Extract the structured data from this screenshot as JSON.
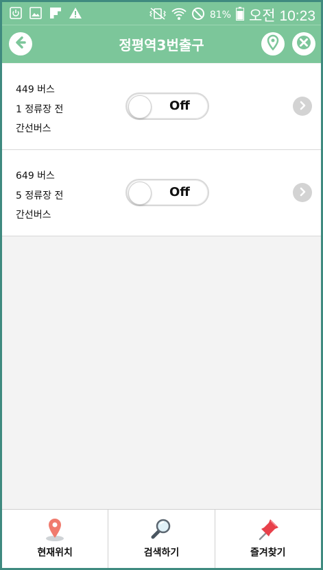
{
  "statusbar": {
    "battery": "81%",
    "time": "오전 10:23",
    "left_icons": [
      "power-icon",
      "image-icon",
      "flipboard-icon",
      "warning-icon"
    ],
    "right_icons": [
      "vibrate-mute-icon",
      "wifi-icon",
      "blocked-icon",
      "battery-icon"
    ]
  },
  "header": {
    "title": "정평역3번출구",
    "back_icon": "back-arrow-icon",
    "location_icon": "location-pin-icon",
    "close_icon": "close-icon",
    "color": "#7cc69a"
  },
  "buses": [
    {
      "line1": "449 버스",
      "line2": "1 정류장 전",
      "line3": "간선버스",
      "toggle": "Off"
    },
    {
      "line1": "649 버스",
      "line2": "5 정류장 전",
      "line3": "간선버스",
      "toggle": "Off"
    }
  ],
  "bottom_nav": [
    {
      "label": "현재위치",
      "icon": "map-pin-icon"
    },
    {
      "label": "검색하기",
      "icon": "magnifier-icon"
    },
    {
      "label": "즐겨찾기",
      "icon": "pushpin-icon"
    }
  ]
}
